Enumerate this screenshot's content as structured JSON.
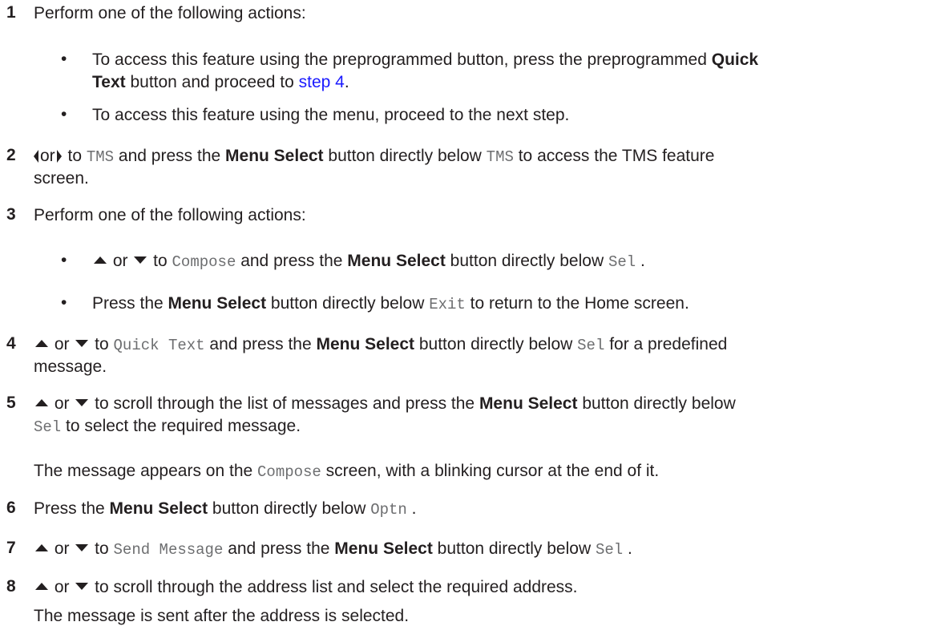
{
  "steps": [
    {
      "num": "1",
      "text": "Perform one of the following actions:",
      "bullets": [
        {
          "a": "To access this feature using the preprogrammed button, press the preprogrammed ",
          "b": "Quick",
          "c": "Text",
          "d": " button and proceed to ",
          "link": "step 4",
          "e": "."
        },
        {
          "a": "To access this feature using the menu, proceed to the next step."
        }
      ]
    },
    {
      "num": "2",
      "or": "or",
      "a": " to ",
      "m1": "TMS",
      "b": " and press the ",
      "bold": "Menu Select",
      "c": " button directly below ",
      "m2": "TMS",
      "d": " to access the TMS feature",
      "e": "screen."
    },
    {
      "num": "3",
      "text": "Perform one of the following actions:",
      "bullets": [
        {
          "or": " or ",
          "a": " to ",
          "m1": "Compose",
          "b": " and press the ",
          "bold": "Menu Select",
          "c": " button directly below ",
          "m2": "Sel",
          "d": " ."
        },
        {
          "a": "Press the ",
          "bold": "Menu Select",
          "b": " button directly below ",
          "m": "Exit",
          "c": " to return to the Home screen."
        }
      ]
    },
    {
      "num": "4",
      "or": " or ",
      "a": " to ",
      "m1": "Quick Text",
      "b": " and press the ",
      "bold": "Menu Select",
      "c": " button directly below ",
      "m2": "Sel",
      "d": " for a predefined",
      "e": "message."
    },
    {
      "num": "5",
      "or": " or ",
      "a": " to scroll through the list of messages and press the ",
      "bold": "Menu Select",
      "b": " button directly below",
      "m": "Sel",
      "c": " to select the required message.",
      "note_a": "The message appears on the ",
      "note_m": "Compose",
      "note_b": " screen, with a blinking cursor at the end of it."
    },
    {
      "num": "6",
      "a": "Press the ",
      "bold": "Menu Select",
      "b": " button directly below ",
      "m": "Optn",
      "c": " ."
    },
    {
      "num": "7",
      "or": " or ",
      "a": " to ",
      "m1": "Send Message",
      "b": " and press the ",
      "bold": "Menu Select",
      "c": " button directly below ",
      "m2": "Sel",
      "d": " ."
    },
    {
      "num": "8",
      "or": " or ",
      "a": " to scroll through the address list and select the required address.",
      "note": "The message is sent after the address is selected."
    }
  ]
}
